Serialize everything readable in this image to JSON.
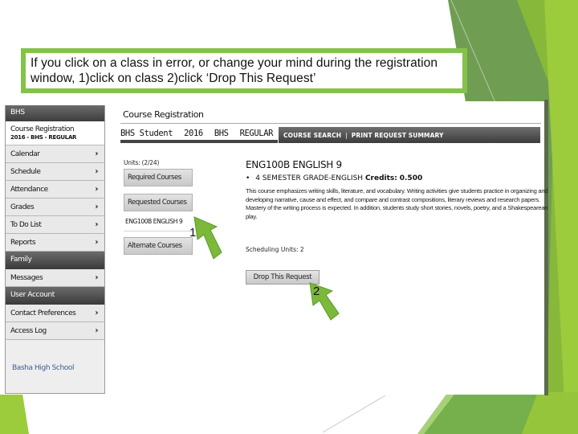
{
  "slide": {
    "accent_color": "#84c24a",
    "dark_green": "#6fa84a",
    "callout_text": "If you click on a class in error, or change your mind during the registration window, 1)click on class 2)click ‘Drop This Request’"
  },
  "sidebar": {
    "header": "BHS",
    "subheader_title": "Course Registration",
    "subheader_detail": "2016 - BHS - REGULAR",
    "items": [
      {
        "label": "Calendar",
        "type": "item",
        "icon": "chevron-right-icon"
      },
      {
        "label": "Schedule",
        "type": "item",
        "icon": "chevron-right-icon"
      },
      {
        "label": "Attendance",
        "type": "item",
        "icon": "chevron-right-icon"
      },
      {
        "label": "Grades",
        "type": "item",
        "icon": "chevron-right-icon"
      },
      {
        "label": "To Do List",
        "type": "item",
        "icon": "chevron-right-icon"
      },
      {
        "label": "Reports",
        "type": "item",
        "icon": "chevron-right-icon"
      },
      {
        "label": "Family",
        "type": "section"
      },
      {
        "label": "Messages",
        "type": "item",
        "icon": "chevron-right-icon"
      },
      {
        "label": "User Account",
        "type": "section"
      },
      {
        "label": "Contact Preferences",
        "type": "item",
        "icon": "chevron-right-icon"
      },
      {
        "label": "Access Log",
        "type": "item",
        "icon": "chevron-right-icon"
      }
    ],
    "footer": "Basha High School"
  },
  "main": {
    "title": "Course Registration",
    "context": {
      "student": "BHS Student",
      "year": "2016",
      "school": "BHS",
      "term": "REGULAR"
    },
    "nav": {
      "course_search": "COURSE SEARCH",
      "separator": "|",
      "print_summary": "PRINT REQUEST SUMMARY"
    },
    "units_label": "Units: (2/24)",
    "buttons": {
      "required": "Required Courses",
      "requested": "Requested Courses",
      "alternate": "Alternate Courses"
    },
    "requested_course_entry": "ENG100B ENGLISH 9",
    "course": {
      "name": "ENG100B ENGLISH 9",
      "bullet": "•",
      "meta": "4 SEMESTER GRADE-ENGLISH",
      "credits_label": "Credits:",
      "credits_value": "0.500",
      "description": "This course emphasizes writing skills, literature, and vocabulary. Writing activities give students practice in organizing and developing narrative, cause and effect, and compare and contrast compositions, literary reviews and research papers. Mastery of the writing process is expected. In addition, students study short stories, novels, poetry, and a Shakespearean play.",
      "scheduling_units": "Scheduling Units: 2",
      "drop_button": "Drop This Request"
    }
  },
  "annotations": [
    {
      "label": "1",
      "target": "requested-course-entry"
    },
    {
      "label": "2",
      "target": "drop-request-button"
    }
  ]
}
